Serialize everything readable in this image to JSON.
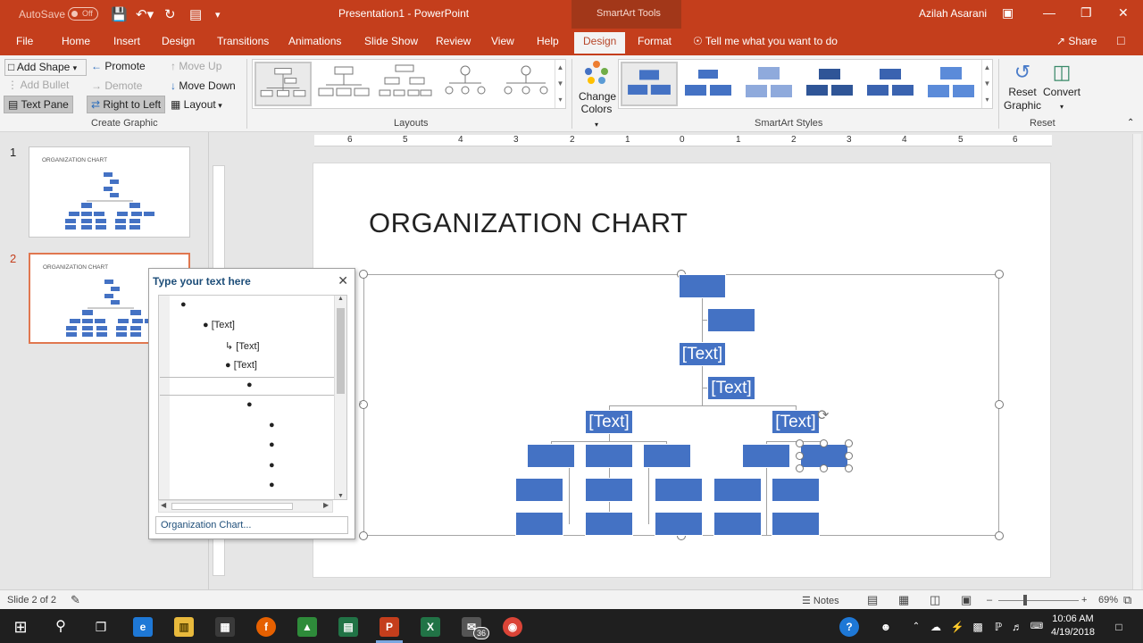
{
  "titlebar": {
    "autosave_label": "AutoSave",
    "autosave_state": "Off",
    "document_title": "Presentation1  -  PowerPoint",
    "context_title": "SmartArt Tools",
    "user": "Azilah Asarani"
  },
  "tabs": [
    {
      "label": "File"
    },
    {
      "label": "Home"
    },
    {
      "label": "Insert"
    },
    {
      "label": "Design"
    },
    {
      "label": "Transitions"
    },
    {
      "label": "Animations"
    },
    {
      "label": "Slide Show"
    },
    {
      "label": "Review"
    },
    {
      "label": "View"
    },
    {
      "label": "Help"
    },
    {
      "label": "Design",
      "active": true
    },
    {
      "label": "Format"
    }
  ],
  "tell_me": "Tell me what you want to do",
  "share": "Share",
  "ribbon": {
    "create_graphic": {
      "add_shape": "Add Shape",
      "add_bullet": "Add Bullet",
      "text_pane": "Text Pane",
      "promote": "Promote",
      "demote": "Demote",
      "right_to_left": "Right to Left",
      "move_up": "Move Up",
      "move_down": "Move Down",
      "layout": "Layout",
      "group_label": "Create Graphic"
    },
    "layouts": {
      "group_label": "Layouts"
    },
    "styles": {
      "change_colors_1": "Change",
      "change_colors_2": "Colors",
      "group_label": "SmartArt Styles"
    },
    "reset": {
      "reset_graphic_1": "Reset",
      "reset_graphic_2": "Graphic",
      "convert": "Convert",
      "group_label": "Reset"
    }
  },
  "slides": [
    {
      "number": "1",
      "title": "ORGANIZATION CHART"
    },
    {
      "number": "2",
      "title": "ORGANIZATION CHART"
    }
  ],
  "ruler_ticks": [
    "6",
    "5",
    "4",
    "3",
    "2",
    "1",
    "0",
    "1",
    "2",
    "3",
    "4",
    "5",
    "6"
  ],
  "slide": {
    "title": "ORGANIZATION CHART",
    "box_text": "[Text]"
  },
  "text_pane": {
    "title": "Type your text here",
    "items": [
      "",
      "[Text]",
      "[Text]",
      "[Text]",
      "",
      "",
      "",
      "",
      "",
      ""
    ],
    "footer": "Organization Chart..."
  },
  "statusbar": {
    "slide_info": "Slide 2 of 2",
    "notes": "Notes",
    "zoom": "69%"
  },
  "taskbar": {
    "time": "10:06 AM",
    "date": "4/19/2018",
    "mail_badge": "36"
  },
  "colors": {
    "accent": "#c43e1c",
    "smartart_blue": "#4472c4"
  }
}
